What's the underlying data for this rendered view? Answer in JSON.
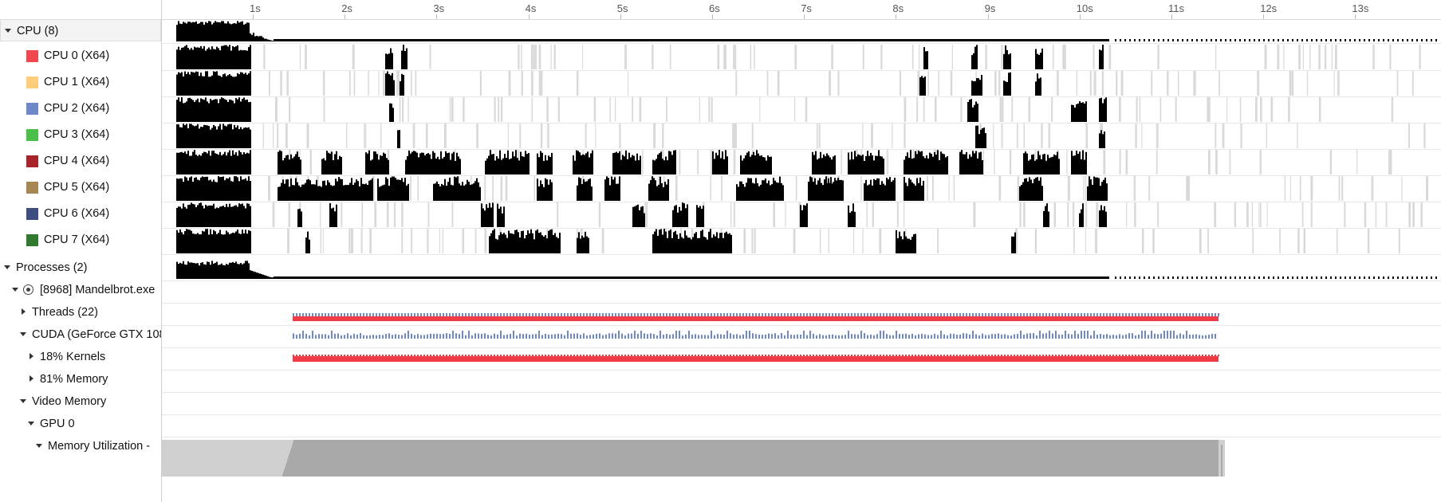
{
  "timeline": {
    "ticks": [
      "1s",
      "2s",
      "3s",
      "4s",
      "5s",
      "6s",
      "7s",
      "8s",
      "9s",
      "10s",
      "11s",
      "12s",
      "13s"
    ]
  },
  "rows": {
    "cpu_group": "CPU (8)",
    "cpus": [
      {
        "label": "CPU 0 (X64)",
        "color": "#f0474e"
      },
      {
        "label": "CPU 1 (X64)",
        "color": "#ffcc7a"
      },
      {
        "label": "CPU 2 (X64)",
        "color": "#6f88c9"
      },
      {
        "label": "CPU 3 (X64)",
        "color": "#4cbf4a"
      },
      {
        "label": "CPU 4 (X64)",
        "color": "#a8222a"
      },
      {
        "label": "CPU 5 (X64)",
        "color": "#a88653"
      },
      {
        "label": "CPU 6 (X64)",
        "color": "#3e4e80"
      },
      {
        "label": "CPU 7 (X64)",
        "color": "#2f7a2f"
      }
    ],
    "processes_group": "Processes (2)",
    "process": "[8968] Mandelbrot.exe",
    "threads": "Threads (22)",
    "cuda": "CUDA (GeForce GTX 108",
    "kernels": "18% Kernels",
    "memory": "81% Memory",
    "video_memory": "Video Memory",
    "gpu": "GPU 0",
    "mem_util": "Memory Utilization -"
  },
  "colors": {
    "activity": "#000000",
    "idle": "#d9d9d9",
    "cuda_red": "#f03a46",
    "cuda_blue": "#6f88c9",
    "gpu_mem_light": "#d0d0d0",
    "gpu_mem_dark": "#a9a9a9"
  }
}
